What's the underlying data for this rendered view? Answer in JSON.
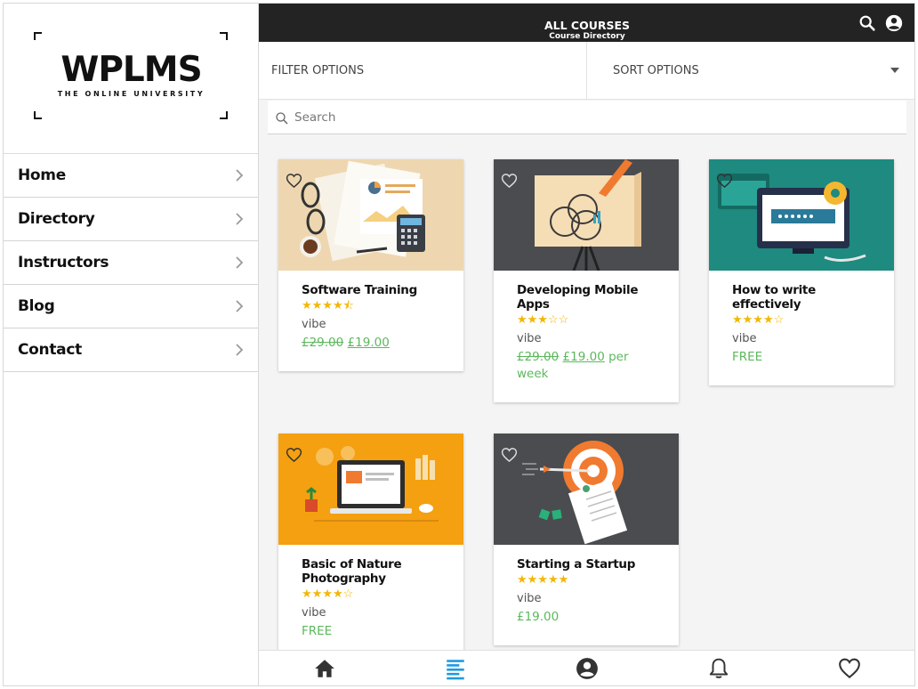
{
  "sidebar": {
    "logo": {
      "title": "WPLMS",
      "subtitle": "THE ONLINE UNIVERSITY"
    },
    "items": [
      {
        "label": "Home"
      },
      {
        "label": "Directory"
      },
      {
        "label": "Instructors"
      },
      {
        "label": "Blog"
      },
      {
        "label": "Contact"
      }
    ]
  },
  "header": {
    "title": "ALL COURSES",
    "subtitle": "Course Directory",
    "icons": [
      "search-icon",
      "account-icon"
    ]
  },
  "filters": {
    "filter_label": "FILTER OPTIONS",
    "sort_label": "SORT OPTIONS"
  },
  "search": {
    "placeholder": "Search",
    "value": ""
  },
  "courses": [
    {
      "title": "Software Training",
      "stars": "★★★★⯪",
      "rating": 4.5,
      "author": "vibe",
      "price_old": "£29.00",
      "price_new": "£19.00",
      "price_suffix": ""
    },
    {
      "title": "Developing Mobile Apps",
      "stars": "★★★☆☆",
      "rating": 3,
      "author": "vibe",
      "price_old": "£29.00",
      "price_new": "£19.00",
      "price_suffix": "per week"
    },
    {
      "title": "How to write effectively",
      "stars": "★★★★☆",
      "rating": 4,
      "author": "vibe",
      "price_free": "FREE"
    },
    {
      "title": "Basic of Nature Photography",
      "stars": "★★★★☆",
      "rating": 4,
      "author": "vibe",
      "price_free": "FREE"
    },
    {
      "title": "Starting a Startup",
      "stars": "★★★★★",
      "rating": 5,
      "author": "vibe",
      "price_plain": "£19.00"
    }
  ],
  "bottom_nav": [
    {
      "icon": "home-icon",
      "active": false
    },
    {
      "icon": "list-icon",
      "active": true
    },
    {
      "icon": "account-icon",
      "active": false
    },
    {
      "icon": "bell-icon",
      "active": false
    },
    {
      "icon": "heart-icon",
      "active": false
    }
  ],
  "colors": {
    "topbar": "#232323",
    "price_green": "#5cb85c",
    "star_gold": "#f2b705",
    "active_nav": "#1e9be0",
    "card1_bg": "#eed7b0",
    "card2_bg": "#4a4c50",
    "card3_bg": "#1e8a80",
    "card4_bg": "#f5a010",
    "card5_bg": "#4a4c50"
  }
}
